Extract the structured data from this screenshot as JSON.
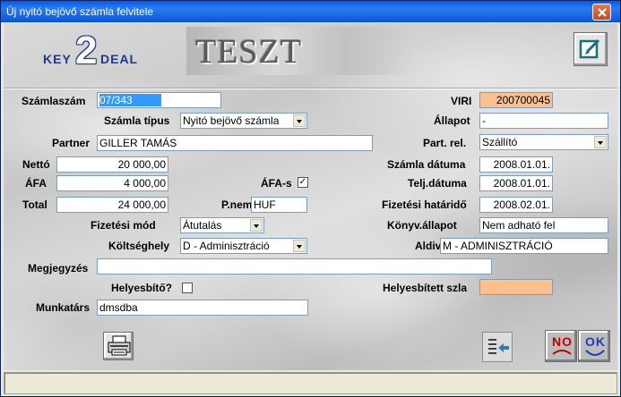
{
  "window": {
    "title": "Új nyitó bejövő számla felvitele"
  },
  "header": {
    "logo_key": "KEY",
    "logo_two": "2",
    "logo_deal": "DEAL",
    "banner": "TESZT"
  },
  "labels": {
    "szamlaszam": "Számlaszám",
    "szamla_tipus": "Számla típus",
    "partner": "Partner",
    "netto": "Nettó",
    "afa": "ÁFA",
    "afa_s": "ÁFA-s",
    "total": "Total",
    "pnem": "P.nem",
    "fizetesi_mod": "Fizetési mód",
    "koltseghely": "Költséghely",
    "megjegyzes": "Megjegyzés",
    "helyesbito": "Helyesbítő?",
    "munkatars": "Munkatárs",
    "viri": "VIRI",
    "allapot": "Állapot",
    "part_rel": "Part. rel.",
    "szamla_datuma": "Számla dátuma",
    "telj_datuma": "Telj.dátuma",
    "fizetesi_hatarido": "Fizetési határidő",
    "konyv_allapot": "Könyv.állapot",
    "aldivizio": "Aldivízió",
    "helyesbitett_szla": "Helyesbített szla"
  },
  "values": {
    "szamlaszam": "07/343",
    "szamla_tipus": "Nyitó bejövő számla",
    "partner": "GILLER TAMÁS",
    "netto": "20 000,00",
    "afa": "4 000,00",
    "afa_s_checked": "✓",
    "total": "24 000,00",
    "pnem": "HUF",
    "fizetesi_mod": "Átutalás",
    "koltseghely": "D - Adminisztráció",
    "megjegyzes": "",
    "helyesbito_checked": "",
    "munkatars": "dmsdba",
    "viri": "200700045",
    "allapot": "-",
    "part_rel": "Szállító",
    "szamla_datuma": "2008.01.01.",
    "telj_datuma": "2008.01.01.",
    "fizetesi_hatarido": "2008.02.01.",
    "konyv_allapot": "Nem adható fel",
    "aldivizio": "M - ADMINISZTRÁCIÓ",
    "helyesbitett_szla": ""
  },
  "buttons": {
    "no_label": "NO",
    "ok_label": "OK"
  },
  "colors": {
    "highlight": "#fac090",
    "selection": "#3399ff",
    "titlebar": "#0b53d8"
  },
  "icons": {
    "edit": "edit-icon",
    "print": "printer-icon",
    "back": "back-arrow-icon",
    "close": "close-icon"
  }
}
